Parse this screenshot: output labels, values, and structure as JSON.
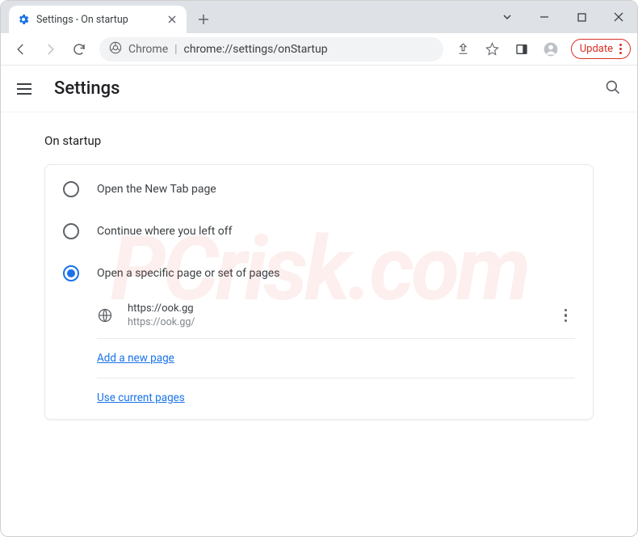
{
  "window": {
    "tab_title": "Settings - On startup"
  },
  "toolbar": {
    "omnibox_label": "Chrome",
    "omnibox_url": "chrome://settings/onStartup",
    "update_label": "Update"
  },
  "header": {
    "title": "Settings"
  },
  "section": {
    "title": "On startup",
    "options": [
      {
        "label": "Open the New Tab page",
        "selected": false
      },
      {
        "label": "Continue where you left off",
        "selected": false
      },
      {
        "label": "Open a specific page or set of pages",
        "selected": true
      }
    ],
    "page": {
      "title": "https://ook.gg",
      "url": "https://ook.gg/"
    },
    "add_link": "Add a new page",
    "use_current_link": "Use current pages"
  },
  "watermark": "PCrisk.com"
}
